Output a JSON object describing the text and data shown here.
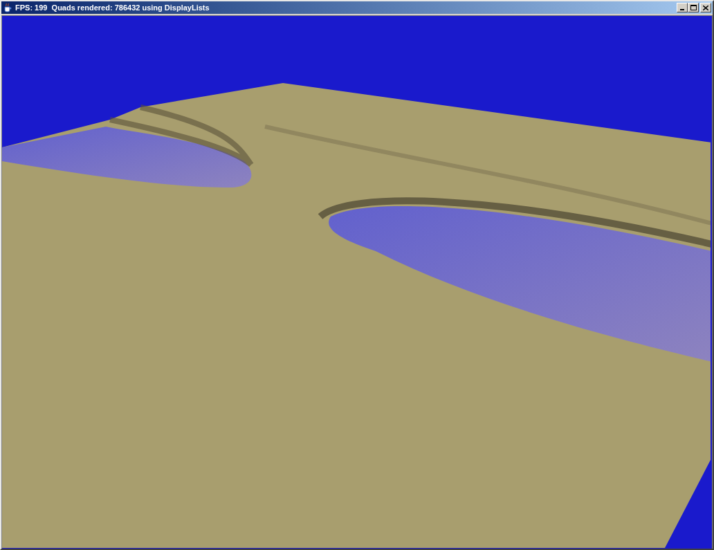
{
  "window": {
    "title": "FPS: 199  Quads rendered: 786432 using DisplayLists"
  }
}
